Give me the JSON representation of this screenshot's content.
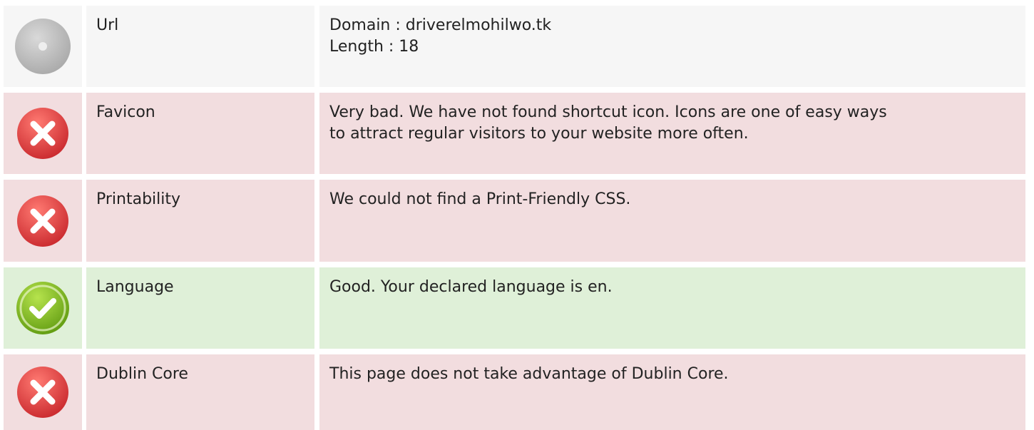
{
  "rows": [
    {
      "status": "neutral",
      "icon": "neutral-disc-icon",
      "label": "Url",
      "lines": [
        "Domain : driverelmohilwo.tk",
        "Length : 18"
      ]
    },
    {
      "status": "bad",
      "icon": "error-cross-icon",
      "label": "Favicon",
      "lines": [
        "Very bad. We have not found shortcut icon. Icons are one of easy ways",
        "to attract regular visitors to your website more often."
      ]
    },
    {
      "status": "bad",
      "icon": "error-cross-icon",
      "label": "Printability",
      "lines": [
        "We could not find a Print-Friendly CSS."
      ]
    },
    {
      "status": "good",
      "icon": "success-check-icon",
      "label": "Language",
      "lines": [
        "Good. Your declared language is en."
      ]
    },
    {
      "status": "bad",
      "icon": "error-cross-icon",
      "label": "Dublin Core",
      "lines": [
        "This page does not take advantage of Dublin Core."
      ]
    }
  ],
  "colors": {
    "bad_bg": "#f2dddf",
    "good_bg": "#dff0d8",
    "neutral_bg": "#f6f6f6",
    "error_red": "#d9353b",
    "success_green": "#7cb518",
    "neutral_grey": "#bdbdbd"
  }
}
